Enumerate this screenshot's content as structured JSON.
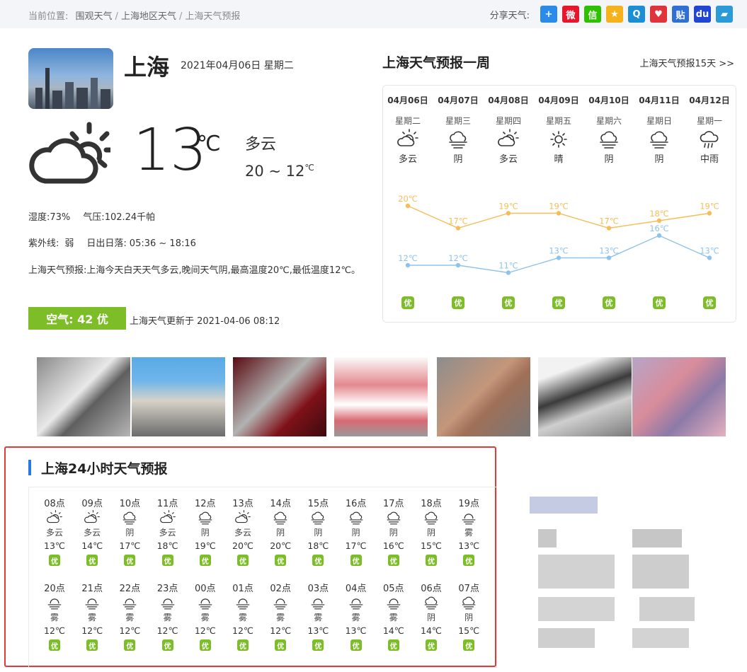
{
  "breadcrumb": {
    "prefix": "当前位置:",
    "items": [
      "围观天气",
      "上海地区天气",
      "上海天气预报"
    ],
    "separator": "/"
  },
  "share": {
    "label": "分享天气:",
    "icons": [
      {
        "name": "plus-share-icon",
        "glyph": "+",
        "color": "#2a8be8"
      },
      {
        "name": "weibo-icon",
        "glyph": "微",
        "color": "#e6162d"
      },
      {
        "name": "wechat-icon",
        "glyph": "信",
        "color": "#2dc100"
      },
      {
        "name": "qzone-icon",
        "glyph": "★",
        "color": "#f6b21a"
      },
      {
        "name": "qq-icon",
        "glyph": "Q",
        "color": "#1b8fd6"
      },
      {
        "name": "heart-icon",
        "glyph": "♥",
        "color": "#e0343c"
      },
      {
        "name": "tieba-icon",
        "glyph": "贴",
        "color": "#2f6fd6"
      },
      {
        "name": "baidu-icon",
        "glyph": "du",
        "color": "#2146d3"
      },
      {
        "name": "note-icon",
        "glyph": "▰",
        "color": "#2a9ad9"
      }
    ]
  },
  "current": {
    "city": "上海",
    "date": "2021年04月06日 星期二",
    "temp": "13",
    "unit": "℃",
    "condition": "多云",
    "range": "20 ~ 12",
    "range_unit": "℃",
    "humidity_label": "湿度:",
    "humidity": "73%",
    "pressure_label": "气压:",
    "pressure": "102.24千帕",
    "uv_label": "紫外线:",
    "uv": "弱",
    "sun_label": "日出日落:",
    "sun": "05:36 ~ 18:16",
    "forecast_text": "上海天气预报:上海今天白天天气多云,晚间天气阴,最高温度20℃,最低温度12℃。",
    "aqi_label": "空气: 42 优",
    "update_text": "上海天气更新于 2021-04-06 08:12",
    "icon": "partly-cloudy-icon"
  },
  "week": {
    "title": "上海天气预报一周",
    "link": "上海天气预报15天 >>",
    "days": [
      {
        "date": "04月06日",
        "weekday": "星期二",
        "icon": "partly-cloudy",
        "cond": "多云",
        "high": 20,
        "low": 12,
        "aqi": "优"
      },
      {
        "date": "04月07日",
        "weekday": "星期三",
        "icon": "overcast",
        "cond": "阴",
        "high": 17,
        "low": 12,
        "aqi": "优"
      },
      {
        "date": "04月08日",
        "weekday": "星期四",
        "icon": "partly-cloudy",
        "cond": "多云",
        "high": 19,
        "low": 11,
        "aqi": "优"
      },
      {
        "date": "04月09日",
        "weekday": "星期五",
        "icon": "sunny",
        "cond": "晴",
        "high": 19,
        "low": 13,
        "aqi": "优"
      },
      {
        "date": "04月10日",
        "weekday": "星期六",
        "icon": "overcast",
        "cond": "阴",
        "high": 17,
        "low": 13,
        "aqi": "优"
      },
      {
        "date": "04月11日",
        "weekday": "星期日",
        "icon": "overcast",
        "cond": "阴",
        "high": 18,
        "low": 16,
        "aqi": "优"
      },
      {
        "date": "04月12日",
        "weekday": "星期一",
        "icon": "rain",
        "cond": "中雨",
        "high": 19,
        "low": 13,
        "aqi": "优"
      }
    ],
    "high_labels": [
      "20℃",
      "17℃",
      "19℃",
      "19℃",
      "17℃",
      "18℃",
      "19℃"
    ],
    "low_labels": [
      "12℃",
      "12℃",
      "11℃",
      "13℃",
      "13℃",
      "16℃",
      "13℃"
    ],
    "high_color": "#f5bd57",
    "low_color": "#8fc3ea"
  },
  "h24": {
    "title": "上海24小时天气预报",
    "hours": [
      {
        "time": "08点",
        "icon": "partly-cloudy",
        "cond": "多云",
        "temp": "13℃",
        "aqi": "优"
      },
      {
        "time": "09点",
        "icon": "partly-cloudy",
        "cond": "多云",
        "temp": "14℃",
        "aqi": "优"
      },
      {
        "time": "10点",
        "icon": "overcast",
        "cond": "阴",
        "temp": "17℃",
        "aqi": "优"
      },
      {
        "time": "11点",
        "icon": "partly-cloudy",
        "cond": "多云",
        "temp": "18℃",
        "aqi": "优"
      },
      {
        "time": "12点",
        "icon": "overcast",
        "cond": "阴",
        "temp": "19℃",
        "aqi": "优"
      },
      {
        "time": "13点",
        "icon": "partly-cloudy",
        "cond": "多云",
        "temp": "20℃",
        "aqi": "优"
      },
      {
        "time": "14点",
        "icon": "overcast",
        "cond": "阴",
        "temp": "20℃",
        "aqi": "优"
      },
      {
        "time": "15点",
        "icon": "overcast",
        "cond": "阴",
        "temp": "18℃",
        "aqi": "优"
      },
      {
        "time": "16点",
        "icon": "overcast",
        "cond": "阴",
        "temp": "17℃",
        "aqi": "优"
      },
      {
        "time": "17点",
        "icon": "overcast",
        "cond": "阴",
        "temp": "16℃",
        "aqi": "优"
      },
      {
        "time": "18点",
        "icon": "overcast",
        "cond": "阴",
        "temp": "15℃",
        "aqi": "优"
      },
      {
        "time": "19点",
        "icon": "fog",
        "cond": "雾",
        "temp": "13℃",
        "aqi": "优"
      },
      {
        "time": "20点",
        "icon": "fog",
        "cond": "雾",
        "temp": "12℃",
        "aqi": "优"
      },
      {
        "time": "21点",
        "icon": "fog",
        "cond": "雾",
        "temp": "12℃",
        "aqi": "优"
      },
      {
        "time": "22点",
        "icon": "fog",
        "cond": "雾",
        "temp": "12℃",
        "aqi": "优"
      },
      {
        "time": "23点",
        "icon": "fog",
        "cond": "雾",
        "temp": "12℃",
        "aqi": "优"
      },
      {
        "time": "00点",
        "icon": "fog",
        "cond": "雾",
        "temp": "12℃",
        "aqi": "优"
      },
      {
        "time": "01点",
        "icon": "fog",
        "cond": "雾",
        "temp": "12℃",
        "aqi": "优"
      },
      {
        "time": "02点",
        "icon": "fog",
        "cond": "雾",
        "temp": "12℃",
        "aqi": "优"
      },
      {
        "time": "03点",
        "icon": "fog",
        "cond": "雾",
        "temp": "13℃",
        "aqi": "优"
      },
      {
        "time": "04点",
        "icon": "fog",
        "cond": "雾",
        "temp": "13℃",
        "aqi": "优"
      },
      {
        "time": "05点",
        "icon": "fog",
        "cond": "雾",
        "temp": "14℃",
        "aqi": "优"
      },
      {
        "time": "06点",
        "icon": "overcast",
        "cond": "阴",
        "temp": "14℃",
        "aqi": "优"
      },
      {
        "time": "07点",
        "icon": "overcast",
        "cond": "阴",
        "temp": "15℃",
        "aqi": "优"
      }
    ]
  },
  "colors": {
    "accent_green": "#7dbd28",
    "title_bar_blue": "#2b78e4",
    "highlight_red": "#e23a34"
  }
}
